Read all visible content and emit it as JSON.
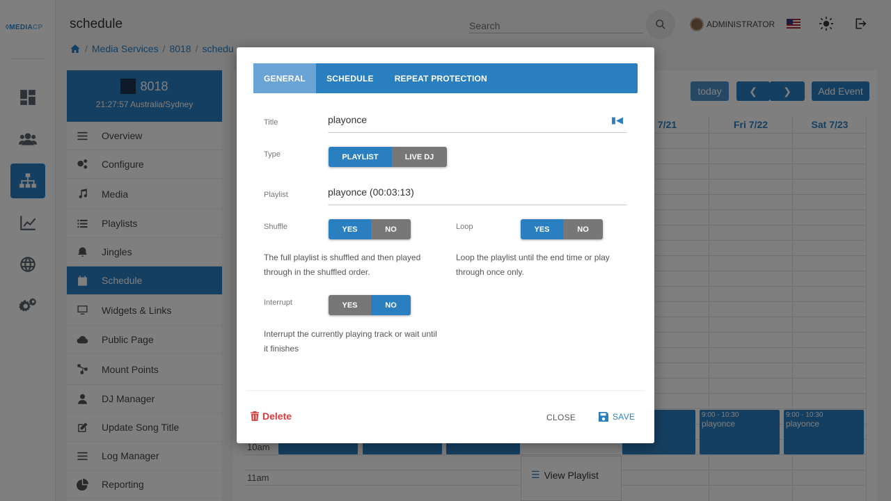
{
  "app": {
    "logo_text_main": "MEDIA",
    "logo_text_accent": "CP",
    "page_title": "schedule"
  },
  "header": {
    "search_placeholder": "Search",
    "user_name": "ADMINISTRATOR"
  },
  "breadcrumb": {
    "items": [
      "Media Services",
      "8018",
      "schedu"
    ]
  },
  "panel": {
    "service_number": "8018",
    "clock": "21:27:57 Australia/Sydney",
    "items": [
      {
        "label": "Overview",
        "icon": "list-icon"
      },
      {
        "label": "Configure",
        "icon": "cogs-icon"
      },
      {
        "label": "Media",
        "icon": "music-icon"
      },
      {
        "label": "Playlists",
        "icon": "list-icon"
      },
      {
        "label": "Jingles",
        "icon": "bell-icon"
      },
      {
        "label": "Schedule",
        "icon": "calendar-icon"
      },
      {
        "label": "Widgets & Links",
        "icon": "monitor-icon"
      },
      {
        "label": "Public Page",
        "icon": "cloud-icon"
      },
      {
        "label": "Mount Points",
        "icon": "nodes-icon"
      },
      {
        "label": "DJ Manager",
        "icon": "user-icon"
      },
      {
        "label": "Update Song Title",
        "icon": "edit-icon"
      },
      {
        "label": "Log Manager",
        "icon": "list-icon"
      },
      {
        "label": "Reporting",
        "icon": "pie-icon"
      }
    ]
  },
  "calendar": {
    "today_label": "today",
    "add_event_label": "Add Event",
    "day_headers": [
      "7/21",
      "Fri 7/22",
      "Sat 7/23"
    ],
    "hours": [
      "10am",
      "11am"
    ],
    "event_time": "9:00 - 10:30",
    "event_title": "playonce",
    "view_playlist_label": "View Playlist"
  },
  "modal": {
    "tabs": [
      "GENERAL",
      "SCHEDULE",
      "REPEAT PROTECTION"
    ],
    "active_tab": "GENERAL",
    "title_label": "Title",
    "title_value": "playonce",
    "type_label": "Type",
    "type_options": [
      "PLAYLIST",
      "LIVE DJ"
    ],
    "type_selected": "PLAYLIST",
    "playlist_label": "Playlist",
    "playlist_value": "playonce (00:03:13)",
    "shuffle_label": "Shuffle",
    "shuffle_yes": "YES",
    "shuffle_no": "NO",
    "shuffle_selected": "YES",
    "shuffle_help": "The full playlist is shuffled and then played through in the shuffled order.",
    "loop_label": "Loop",
    "loop_yes": "YES",
    "loop_no": "NO",
    "loop_selected": "YES",
    "loop_help": "Loop the playlist until the end time or play through once only.",
    "interrupt_label": "Interrupt",
    "interrupt_yes": "YES",
    "interrupt_no": "NO",
    "interrupt_selected": "NO",
    "interrupt_help": "Interrupt the currently playing track or wait until it finishes",
    "delete_label": "Delete",
    "close_label": "CLOSE",
    "save_label": "SAVE"
  },
  "colors": {
    "accent": "#2a7fc0",
    "danger": "#d63a3a",
    "toggle_off": "#777777"
  }
}
